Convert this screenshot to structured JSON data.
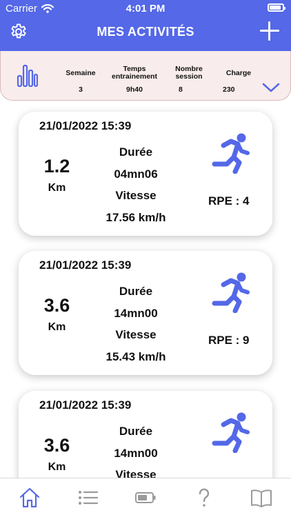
{
  "status_bar": {
    "carrier": "Carrier",
    "time": "4:01 PM"
  },
  "header": {
    "title": "MES ACTIVITÉS"
  },
  "summary": {
    "stats": [
      {
        "label_line1": "Semaine",
        "label_line2": "",
        "value": "3"
      },
      {
        "label_line1": "Temps",
        "label_line2": "entrainement",
        "value": "9h40"
      },
      {
        "label_line1": "Nombre",
        "label_line2": "session",
        "value": "8"
      },
      {
        "label_line1": "Charge",
        "label_line2": "",
        "value": "230"
      }
    ]
  },
  "activities": [
    {
      "date": "21/01/2022 15:39",
      "distance": "1.2",
      "unit": "Km",
      "duration_label": "Durée",
      "duration": "04mn06",
      "speed_label": "Vitesse",
      "speed": "17.56 km/h",
      "rpe": "RPE : 4"
    },
    {
      "date": "21/01/2022 15:39",
      "distance": "3.6",
      "unit": "Km",
      "duration_label": "Durée",
      "duration": "14mn00",
      "speed_label": "Vitesse",
      "speed": "15.43 km/h",
      "rpe": "RPE : 9"
    },
    {
      "date": "21/01/2022 15:39",
      "distance": "3.6",
      "unit": "Km",
      "duration_label": "Durée",
      "duration": "14mn00",
      "speed_label": "Vitesse",
      "speed": "",
      "rpe": ""
    }
  ],
  "colors": {
    "accent": "#5468e8",
    "summary_bg": "#f9ecec",
    "rpe_partial": "#ea5c5c"
  },
  "tabbar": {
    "icons": [
      "home-icon",
      "list-icon",
      "battery-icon",
      "help-icon",
      "book-icon"
    ],
    "active_index": 0
  }
}
